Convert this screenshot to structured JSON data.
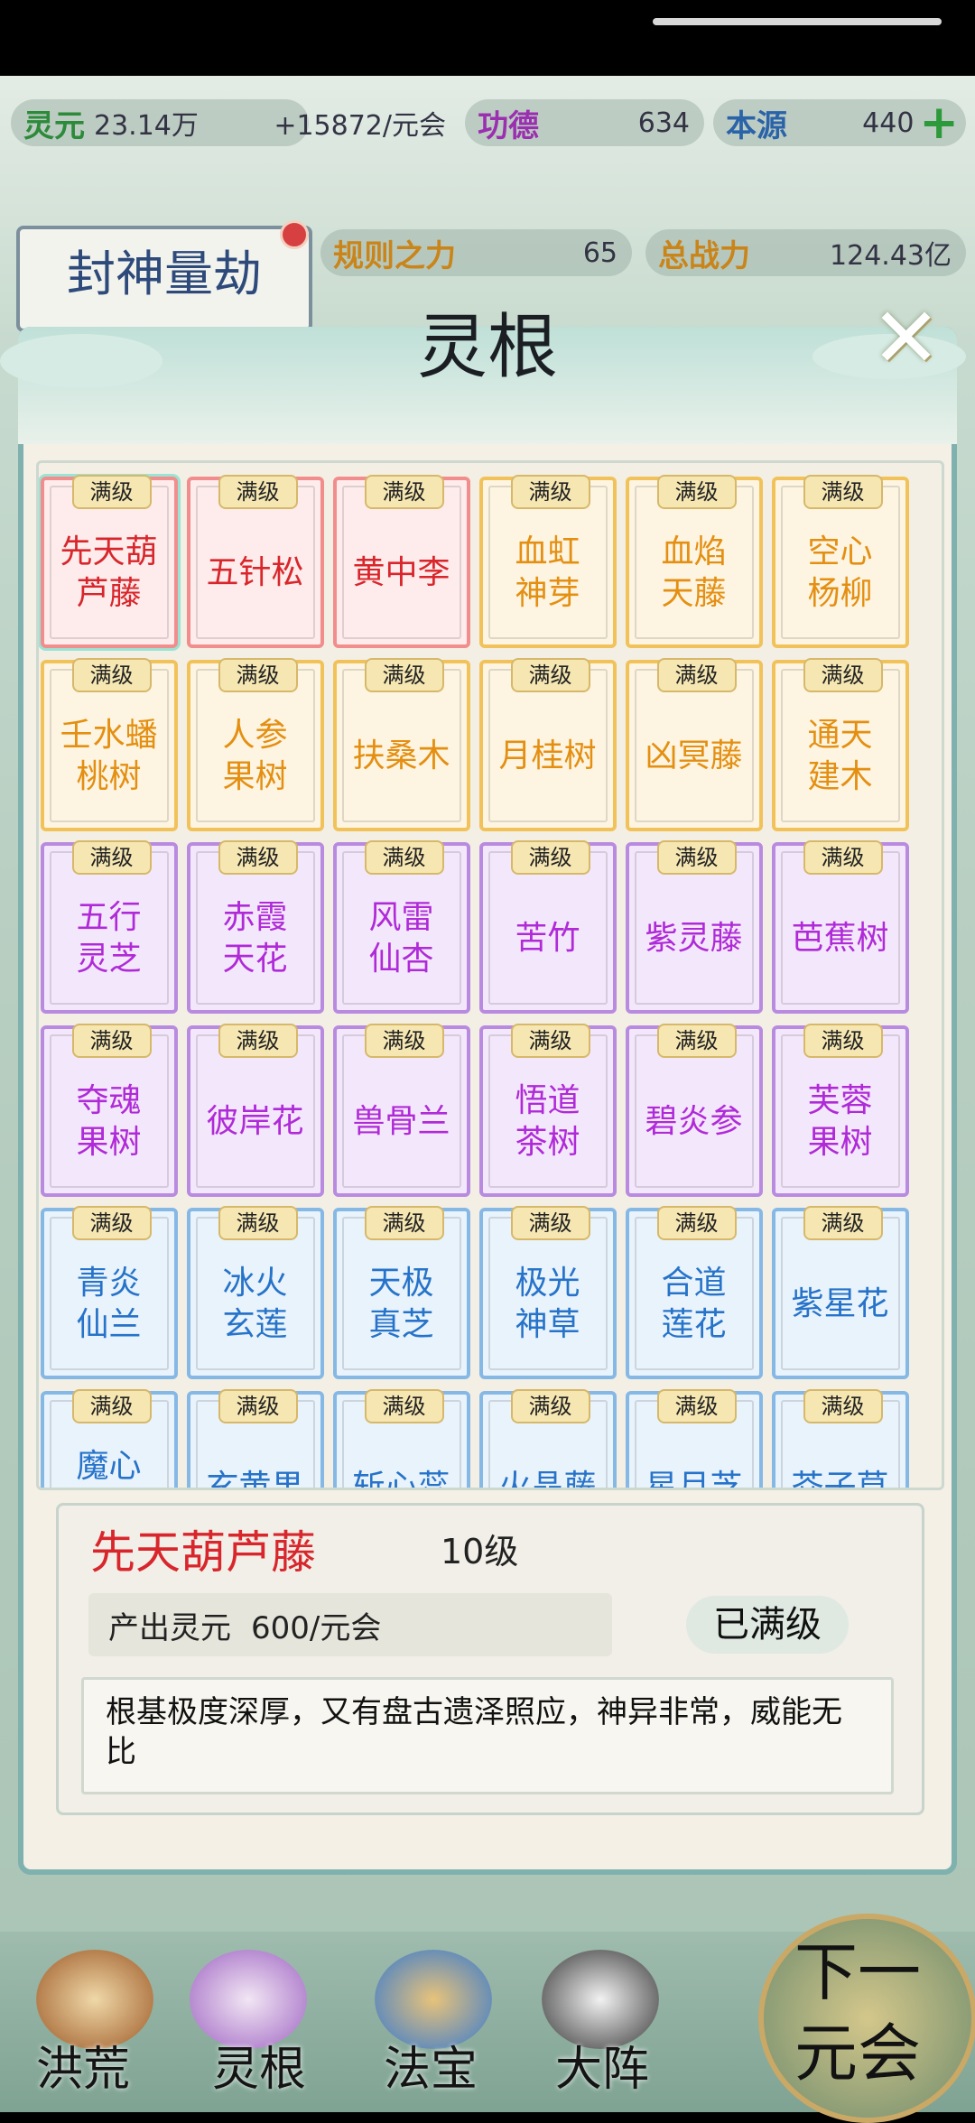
{
  "hud": {
    "lingyuan_label": "灵元",
    "lingyuan_value": "23.14万",
    "lingyuan_rate": "+15872/元会",
    "gongde_label": "功德",
    "gongde_value": "634",
    "benyuan_label": "本源",
    "benyuan_value": "440",
    "guize_label": "规则之力",
    "guize_value": "65",
    "zhanli_label": "总战力",
    "zhanli_value": "124.43亿",
    "event_title": "封神量劫"
  },
  "panel": {
    "title": "灵根",
    "close_icon": "close-icon"
  },
  "badge_text": "满级",
  "cards": [
    {
      "name": "先天葫\n芦藤",
      "tier": "red"
    },
    {
      "name": "五针松",
      "tier": "red"
    },
    {
      "name": "黄中李",
      "tier": "red"
    },
    {
      "name": "血虹\n神芽",
      "tier": "orange"
    },
    {
      "name": "血焰\n天藤",
      "tier": "orange"
    },
    {
      "name": "空心\n杨柳",
      "tier": "orange"
    },
    {
      "name": "壬水蟠\n桃树",
      "tier": "orange"
    },
    {
      "name": "人参\n果树",
      "tier": "orange"
    },
    {
      "name": "扶桑木",
      "tier": "orange"
    },
    {
      "name": "月桂树",
      "tier": "orange"
    },
    {
      "name": "凶冥藤",
      "tier": "orange"
    },
    {
      "name": "通天\n建木",
      "tier": "orange"
    },
    {
      "name": "五行\n灵芝",
      "tier": "purple"
    },
    {
      "name": "赤霞\n天花",
      "tier": "purple"
    },
    {
      "name": "风雷\n仙杏",
      "tier": "purple"
    },
    {
      "name": "苦竹",
      "tier": "purple"
    },
    {
      "name": "紫灵藤",
      "tier": "purple"
    },
    {
      "name": "芭蕉树",
      "tier": "purple"
    },
    {
      "name": "夺魂\n果树",
      "tier": "purple"
    },
    {
      "name": "彼岸花",
      "tier": "purple"
    },
    {
      "name": "兽骨兰",
      "tier": "purple"
    },
    {
      "name": "悟道\n茶树",
      "tier": "purple"
    },
    {
      "name": "碧炎参",
      "tier": "purple"
    },
    {
      "name": "芙蓉\n果树",
      "tier": "purple"
    },
    {
      "name": "青炎\n仙兰",
      "tier": "blue"
    },
    {
      "name": "冰火\n玄莲",
      "tier": "blue"
    },
    {
      "name": "天极\n真芝",
      "tier": "blue"
    },
    {
      "name": "极光\n神草",
      "tier": "blue"
    },
    {
      "name": "合道\n莲花",
      "tier": "blue"
    },
    {
      "name": "紫星花",
      "tier": "blue"
    },
    {
      "name": "魔心\n果树",
      "tier": "blue"
    },
    {
      "name": "玄黄果",
      "tier": "blue"
    },
    {
      "name": "斩心蕊",
      "tier": "blue"
    },
    {
      "name": "火晶藤",
      "tier": "blue"
    },
    {
      "name": "星月芝",
      "tier": "blue"
    },
    {
      "name": "芥子草",
      "tier": "blue"
    }
  ],
  "detail": {
    "name": "先天葫芦藤",
    "level": "10级",
    "output_label": "产出灵元",
    "output_value": "600/元会",
    "status": "已满级",
    "description": "根基极度深厚，又有盘古遗泽照应，神异非常，威能无比"
  },
  "nav": {
    "items": [
      "洪荒",
      "灵根",
      "法宝",
      "大阵"
    ],
    "next_label": "下一\n元会"
  },
  "colors": {
    "red_tier": "#d8262c",
    "orange_tier": "#e48f12",
    "purple_tier": "#b02ad8",
    "blue_tier": "#2673c9",
    "panel_border": "#7fb1ae"
  }
}
